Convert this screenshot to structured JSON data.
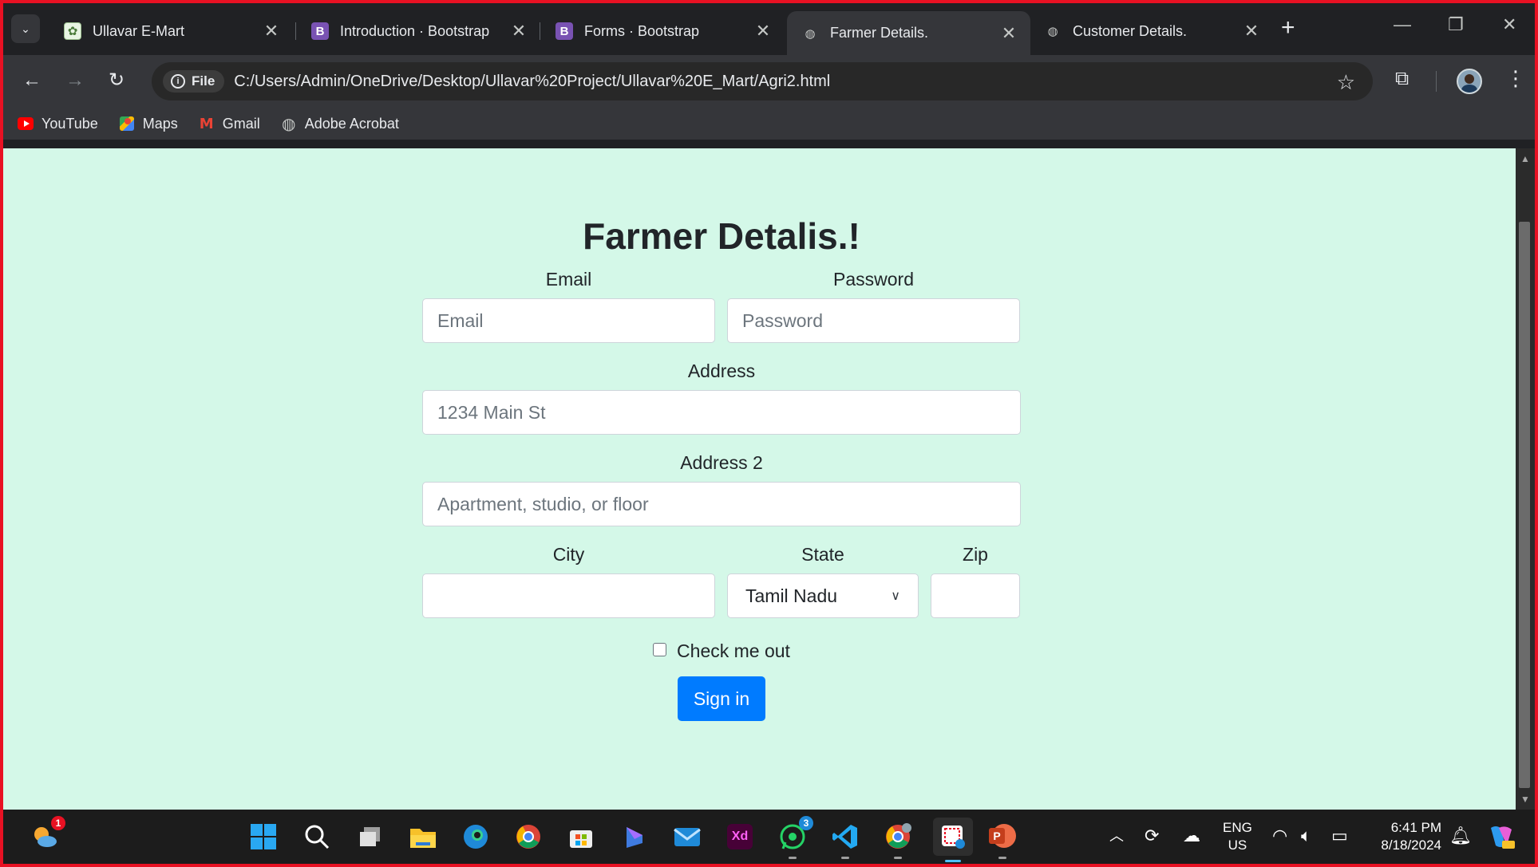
{
  "browser": {
    "tabs": [
      {
        "title": "Ullavar E-Mart",
        "favicon": "ullavar-logo-icon",
        "active": false
      },
      {
        "title": "Introduction · Bootstrap",
        "favicon": "bootstrap-icon",
        "active": false
      },
      {
        "title": "Forms · Bootstrap",
        "favicon": "bootstrap-icon",
        "active": false
      },
      {
        "title": "Farmer Details.",
        "favicon": "globe-icon",
        "active": true
      },
      {
        "title": "Customer Details.",
        "favicon": "globe-icon",
        "active": false
      }
    ],
    "favicon_b": "B",
    "address": {
      "chip_label": "File",
      "url": "C:/Users/Admin/OneDrive/Desktop/Ullavar%20Project/Ullavar%20E_Mart/Agri2.html"
    },
    "bookmarks": [
      {
        "label": "YouTube",
        "icon": "youtube-icon"
      },
      {
        "label": "Maps",
        "icon": "maps-icon"
      },
      {
        "label": "Gmail",
        "icon": "gmail-icon"
      },
      {
        "label": "Adobe Acrobat",
        "icon": "globe-icon"
      }
    ]
  },
  "page": {
    "heading": "Farmer Detalis.!",
    "email": {
      "label": "Email",
      "placeholder": "Email"
    },
    "password": {
      "label": "Password",
      "placeholder": "Password"
    },
    "address": {
      "label": "Address",
      "placeholder": "1234 Main St"
    },
    "address2": {
      "label": "Address 2",
      "placeholder": "Apartment, studio, or floor"
    },
    "city": {
      "label": "City",
      "value": ""
    },
    "state": {
      "label": "State",
      "selected": "Tamil Nadu"
    },
    "zip": {
      "label": "Zip",
      "value": ""
    },
    "checkbox_label": "Check me out",
    "submit_label": "Sign in",
    "background": "#d4f8e8",
    "button_color": "#007bff"
  },
  "taskbar": {
    "weather_badge": "1",
    "whatsapp_badge": "3",
    "xd_label": "Xd",
    "powerpoint_label": "P",
    "language": "ENG",
    "region": "US",
    "time": "6:41 PM",
    "date": "8/18/2024"
  }
}
